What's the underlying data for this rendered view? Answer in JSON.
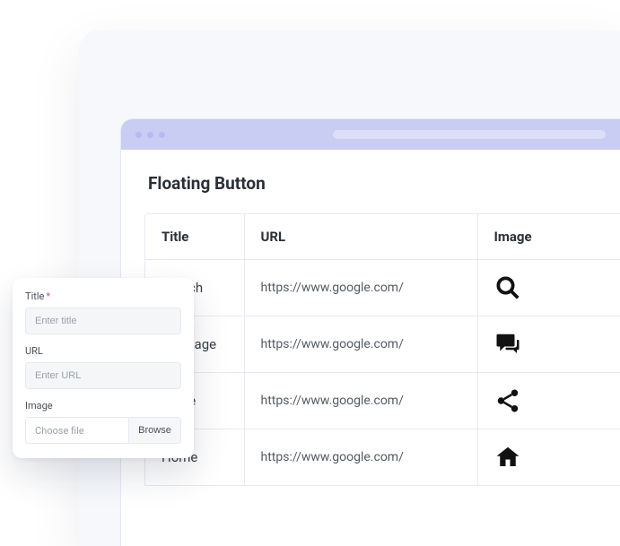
{
  "page": {
    "title": "Floating Button"
  },
  "table": {
    "headers": [
      "Title",
      "URL",
      "Image"
    ],
    "rows": [
      {
        "title": "Search",
        "url": "https://www.google.com/",
        "icon": "search"
      },
      {
        "title": "Message",
        "url": "https://www.google.com/",
        "icon": "chat"
      },
      {
        "title": "Share",
        "url": "https://www.google.com/",
        "icon": "share"
      },
      {
        "title": "Home",
        "url": "https://www.google.com/",
        "icon": "home"
      }
    ]
  },
  "form": {
    "title_label": "Title",
    "title_placeholder": "Enter title",
    "url_label": "URL",
    "url_placeholder": "Enter URL",
    "image_label": "Image",
    "image_choose": "Choose file",
    "image_browse": "Browse"
  }
}
